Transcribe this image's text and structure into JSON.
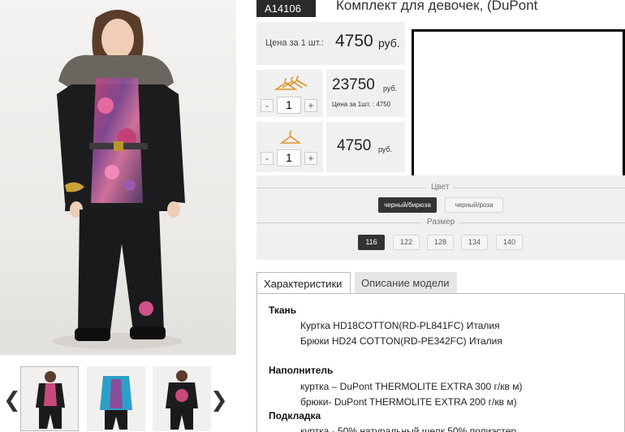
{
  "product": {
    "sku": "A14106",
    "title": "Комплект для девочек, (DuPont"
  },
  "price": {
    "unit_label": "Цена за 1 шт.:",
    "unit_value": "4750",
    "currency": "руб.",
    "set_total": "23750",
    "set_currency": "руб.",
    "set_note": "Цена за 1шт. : 4750",
    "single_total": "4750",
    "single_currency": "руб."
  },
  "steppers": {
    "set": {
      "minus": "-",
      "qty": "1",
      "plus": "+"
    },
    "single": {
      "minus": "-",
      "qty": "1",
      "plus": "+"
    }
  },
  "options": {
    "color_label": "Цвет",
    "colors": [
      "черный/бирюза",
      "черный/роза"
    ],
    "selected_color": "черный/бирюза",
    "size_label": "Размер",
    "sizes": [
      "116",
      "122",
      "128",
      "134",
      "140"
    ],
    "selected_size": "116"
  },
  "tabs": {
    "characteristics": "Характеристики",
    "description": "Описание модели"
  },
  "specs": {
    "fabric_title": "Ткань",
    "fabric_lines": [
      "Куртка HD18COTTON(RD-PL841FC) Италия",
      "Брюки HD24 COTTON(RD-PE342FC) Италия"
    ],
    "filler_title": "Наполнитель",
    "filler_lines": [
      "куртка – DuPont THERMOLITE EXTRA 300 г/кв м)",
      "брюки- DuPont THERMOLITE EXTRA 200 г/кв м)"
    ],
    "lining_title": "Подкладка",
    "lining_line": "куртка - 50% натуральный шелк 50% полиэстер"
  },
  "gallery": {
    "prev": "❮",
    "next": "❯"
  },
  "colors": {
    "dark_panel": "#2a2a2a",
    "panel_bg": "#f0f0f0",
    "jacket": "#1c1c1e",
    "accent_pink": "#d0508c",
    "accent_teal": "#2aa0c8"
  }
}
